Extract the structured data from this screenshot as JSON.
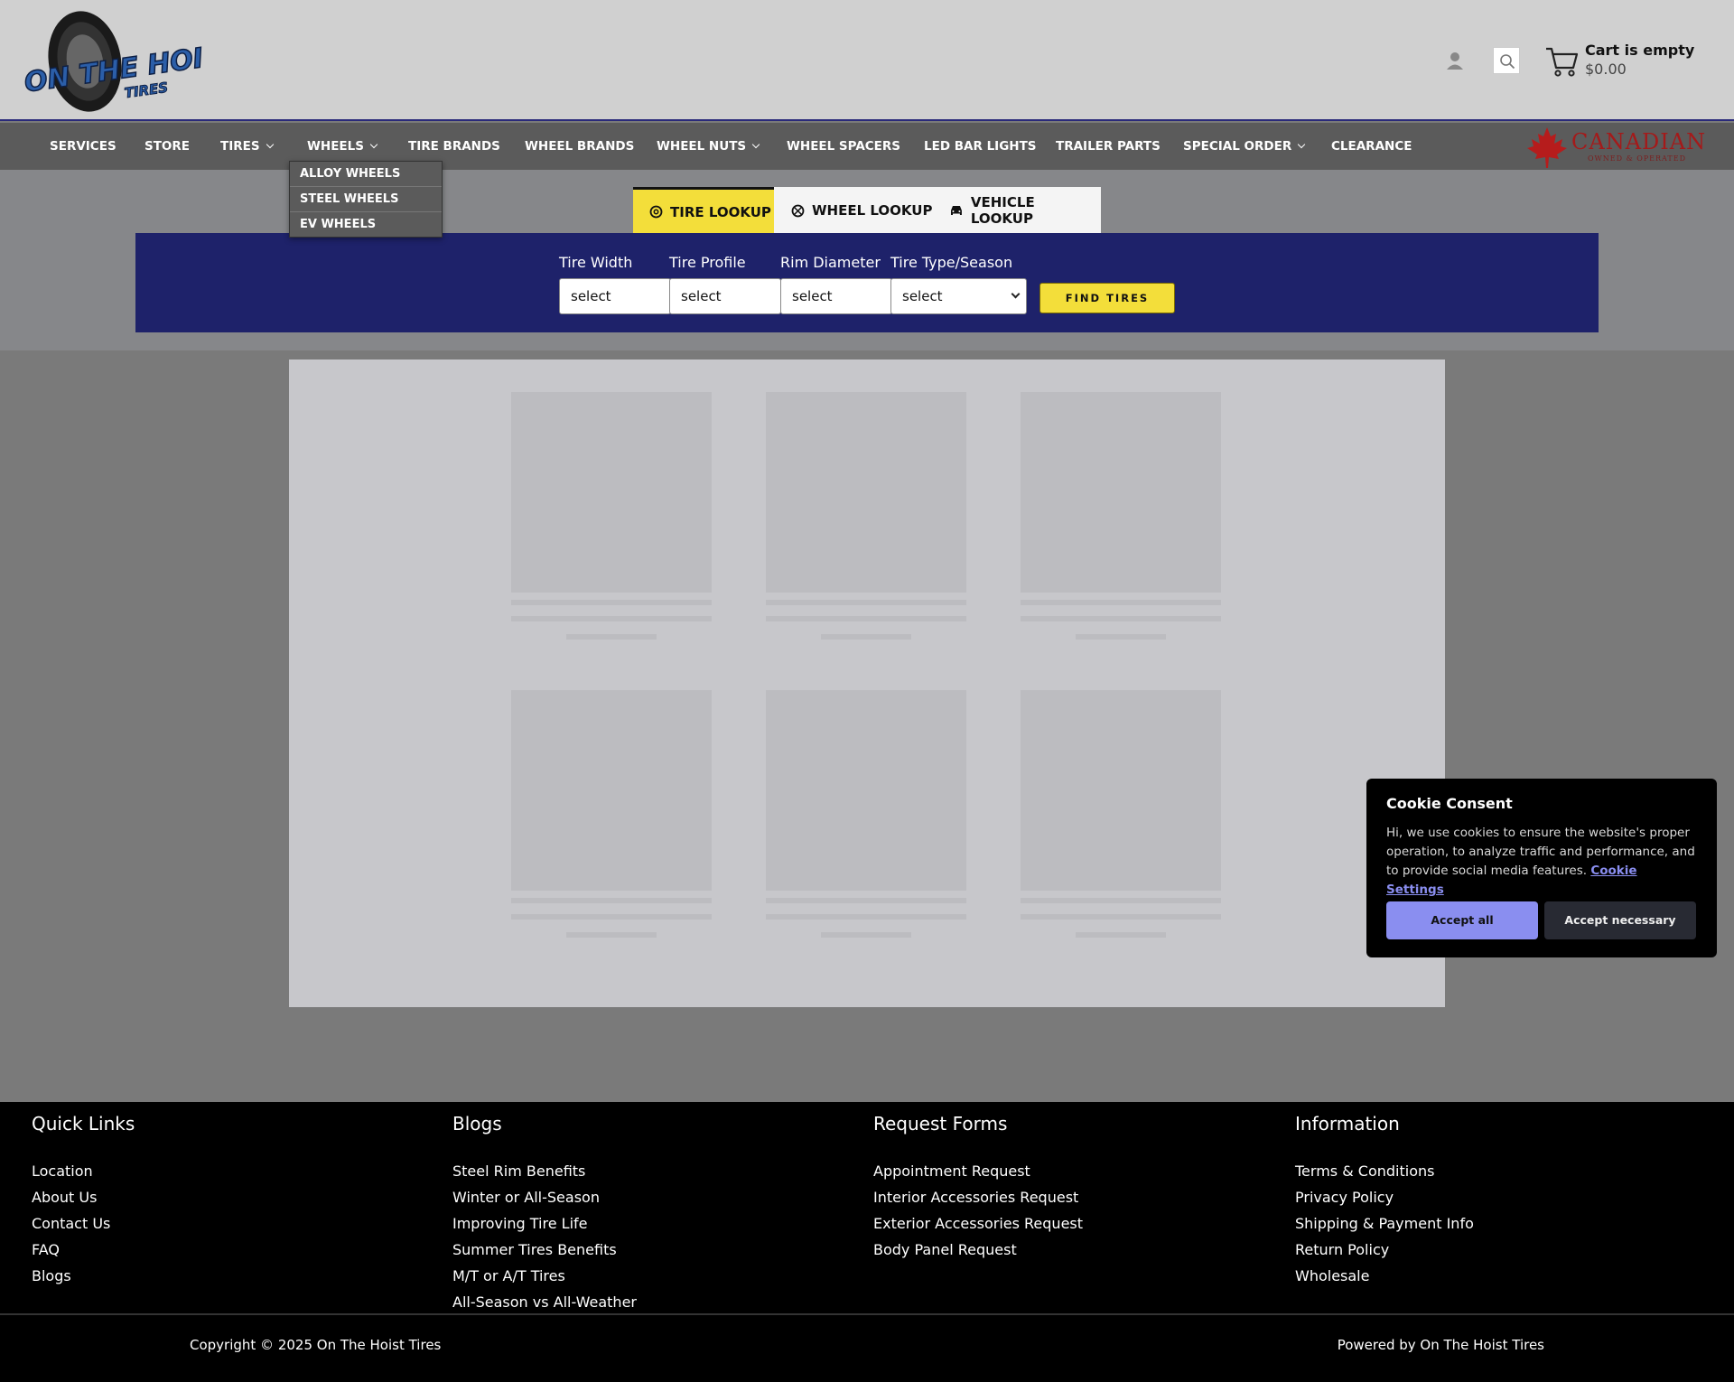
{
  "header": {
    "logo_text": "ON THE HOIST TIRES",
    "cart_title": "Cart is empty",
    "cart_total": "$0.00"
  },
  "nav": {
    "items": [
      {
        "label": "SERVICES"
      },
      {
        "label": "STORE"
      },
      {
        "label": "TIRES"
      },
      {
        "label": "WHEELS"
      },
      {
        "label": "TIRE BRANDS"
      },
      {
        "label": "WHEEL BRANDS"
      },
      {
        "label": "WHEEL NUTS"
      },
      {
        "label": "WHEEL SPACERS"
      },
      {
        "label": "LED BAR LIGHTS"
      },
      {
        "label": "TRAILER PARTS"
      },
      {
        "label": "SPECIAL ORDER"
      },
      {
        "label": "CLEARANCE"
      }
    ],
    "canadian": "CANADIAN",
    "canadian_sub": "OWNED & OPERATED",
    "wheels_dropdown": [
      "ALLOY WHEELS",
      "STEEL WHEELS",
      "EV WHEELS"
    ]
  },
  "lookup": {
    "tabs": [
      "TIRE LOOKUP",
      "WHEEL LOOKUP",
      "VEHICLE LOOKUP"
    ],
    "fields": [
      {
        "label": "Tire Width",
        "value": "select"
      },
      {
        "label": "Tire Profile",
        "value": "select"
      },
      {
        "label": "Rim Diameter",
        "value": "select"
      },
      {
        "label": "Tire Type/Season",
        "value": "select"
      }
    ],
    "find_button": "FIND TIRES"
  },
  "cookie": {
    "title": "Cookie Consent",
    "text": "Hi, we use cookies to ensure the website's proper operation, to analyze traffic and performance, and to provide social media features.",
    "link": "Cookie Settings",
    "accept_all": "Accept all",
    "accept_necessary": "Accept necessary"
  },
  "footer": {
    "columns": [
      {
        "heading": "Quick Links",
        "links": [
          "Location",
          "About Us",
          "Contact Us",
          "FAQ",
          "Blogs"
        ]
      },
      {
        "heading": "Blogs",
        "links": [
          "Steel Rim Benefits",
          "Winter or All-Season",
          "Improving Tire Life",
          "Summer Tires Benefits",
          "M/T or A/T Tires",
          "All-Season vs All-Weather"
        ]
      },
      {
        "heading": "Request Forms",
        "links": [
          "Appointment Request",
          "Interior Accessories Request",
          "Exterior Accessories Request",
          "Body Panel Request"
        ]
      },
      {
        "heading": "Information",
        "links": [
          "Terms & Conditions",
          "Privacy Policy",
          "Shipping & Payment Info",
          "Return Policy",
          "Wholesale"
        ]
      }
    ],
    "copyright": "Copyright © 2025 On The Hoist Tires",
    "powered": "Powered by On The Hoist Tires"
  },
  "colors": {
    "accent_yellow": "#f3de3a",
    "panel_navy": "#1e226a",
    "cookie_button": "#8a8ef0"
  }
}
